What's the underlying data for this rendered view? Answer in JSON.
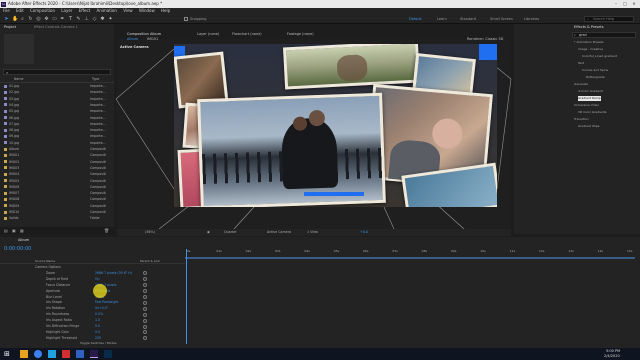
{
  "title": "Adobe After Effects 2020 - C:\\Users\\Nijat Ibrahimli\\Desktop\\love_album.aep *",
  "menu": [
    "File",
    "Edit",
    "Composition",
    "Layer",
    "Effect",
    "Animation",
    "View",
    "Window",
    "Help"
  ],
  "toolbar": {
    "snapping": "Snapping",
    "workspaces": [
      "Default",
      "Learn",
      "Standard",
      "Small Screen",
      "Libraries"
    ],
    "search_placeholder": "Search Help"
  },
  "project_panel": {
    "tab": "Project",
    "tab2": "Effect Controls Camera 1",
    "col_name": "Name",
    "col_type": "Type",
    "items": [
      {
        "name": "01.jpg",
        "type": "Importe...",
        "color": "#8a8ac8"
      },
      {
        "name": "02.jpg",
        "type": "Importe...",
        "color": "#8a8ac8"
      },
      {
        "name": "03.jpg",
        "type": "Importe...",
        "color": "#8a8ac8"
      },
      {
        "name": "04.jpg",
        "type": "Importe...",
        "color": "#8a8ac8"
      },
      {
        "name": "05.jpg",
        "type": "Importe...",
        "color": "#8a8ac8"
      },
      {
        "name": "06.jpg",
        "type": "Importe...",
        "color": "#8a8ac8"
      },
      {
        "name": "07.jpg",
        "type": "Importe...",
        "color": "#8a8ac8"
      },
      {
        "name": "08.jpg",
        "type": "Importe...",
        "color": "#8a8ac8"
      },
      {
        "name": "09.jpg",
        "type": "Importe...",
        "color": "#8a8ac8"
      },
      {
        "name": "10.jpg",
        "type": "Importe...",
        "color": "#8a8ac8"
      },
      {
        "name": "Album",
        "type": "Compositi",
        "color": "#c8a850"
      },
      {
        "name": "IMG01",
        "type": "Compositi",
        "color": "#c8a850"
      },
      {
        "name": "IMG02",
        "type": "Compositi",
        "color": "#c8a850"
      },
      {
        "name": "IMG03",
        "type": "Compositi",
        "color": "#c8a850"
      },
      {
        "name": "IMG04",
        "type": "Compositi",
        "color": "#c8a850"
      },
      {
        "name": "IMG05",
        "type": "Compositi",
        "color": "#c8a850"
      },
      {
        "name": "IMG06",
        "type": "Compositi",
        "color": "#c8a850"
      },
      {
        "name": "IMG07",
        "type": "Compositi",
        "color": "#c8a850"
      },
      {
        "name": "IMG08",
        "type": "Compositi",
        "color": "#c8a850"
      },
      {
        "name": "IMG09",
        "type": "Compositi",
        "color": "#c8a850"
      },
      {
        "name": "IMG10",
        "type": "Compositi",
        "color": "#c8a850"
      },
      {
        "name": "Solids",
        "type": "Folder",
        "color": "#c8a850"
      }
    ]
  },
  "viewer": {
    "tabs": [
      "Album",
      "IMG01"
    ],
    "comp_tab": "Composition Album",
    "layer_tab": "Layer (none)",
    "footage_tab": "Footage (none)",
    "flowchart_tab": "Flowchart (none)",
    "label": "Active Camera",
    "renderer": "Renderer: Classic 3D",
    "zoom": "(36%)",
    "resolution": "Quarter",
    "camera": "Active Camera",
    "views": "1 View",
    "exposure": "+0.0"
  },
  "effects_panel": {
    "tab": "Effects & Presets",
    "search": "grad",
    "items": [
      {
        "label": "* Animation Presets",
        "indent": 0
      },
      {
        "label": "Image - Creative",
        "indent": 1
      },
      {
        "label": "Colorful_Lined gradient",
        "indent": 2
      },
      {
        "label": "Text",
        "indent": 1
      },
      {
        "label": "Curves and Spins",
        "indent": 2
      },
      {
        "label": "Rottengrade",
        "indent": 3
      },
      {
        "label": "Generate",
        "indent": 0
      },
      {
        "label": "4-Color Gradient",
        "indent": 1
      },
      {
        "label": "Gradient Ramp",
        "indent": 1,
        "selected": true
      },
      {
        "label": "Immersive Video",
        "indent": 0
      },
      {
        "label": "VR Color Gradients",
        "indent": 1
      },
      {
        "label": "Transition",
        "indent": 0
      },
      {
        "label": "Gradient Wipe",
        "indent": 1
      }
    ]
  },
  "timeline": {
    "tab": "Album",
    "timecode": "0:00:00:00",
    "col_source": "Source Name",
    "col_parent": "Parent & Link",
    "rows": [
      {
        "name": "Camera Options",
        "value": ""
      },
      {
        "name": "Zoom",
        "value": "2666.7 pixels (39.6° H)"
      },
      {
        "name": "Depth of Field",
        "value": "On"
      },
      {
        "name": "Focus Distance",
        "value": "2666.7 pixels"
      },
      {
        "name": "Aperture",
        "value": "0.0 pixels"
      },
      {
        "name": "Blur Level",
        "value": "100%"
      },
      {
        "name": "Iris Shape",
        "value": "Fast Rectangle"
      },
      {
        "name": "Iris Rotation",
        "value": "0x+0.0°"
      },
      {
        "name": "Iris Roundness",
        "value": "0.0%"
      },
      {
        "name": "Iris Aspect Ratio",
        "value": "1.0"
      },
      {
        "name": "Iris Diffraction Fringe",
        "value": "0.0"
      },
      {
        "name": "Highlight Gain",
        "value": "0.0"
      },
      {
        "name": "Highlight Threshold",
        "value": "255"
      }
    ],
    "ruler": [
      "0s",
      "01s",
      "02s",
      "03s",
      "04s",
      "05s",
      "06s",
      "07s",
      "08s",
      "09s",
      "10s",
      "11s",
      "12s",
      "13s",
      "14s",
      "15s"
    ],
    "bottom": "Toggle Switches / Modes"
  },
  "taskbar": {
    "time": "5:00 PM",
    "date": "2/4/2020"
  },
  "colors": {
    "accent": "#3a95ea",
    "cursor_highlight": "#f2e21a",
    "blue_solid": "#1f6ff0"
  }
}
